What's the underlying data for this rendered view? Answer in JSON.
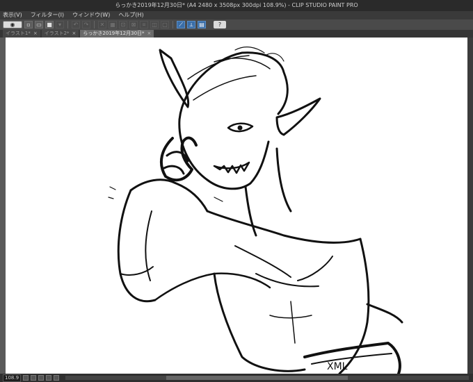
{
  "window": {
    "title": "らっかき2019年12月30日* (A4 2480 x 3508px 300dpi 108.9%)  - CLIP STUDIO PAINT PRO"
  },
  "menu": {
    "items": [
      "表示(V)",
      "フィルター(I)",
      "ウィンドウ(W)",
      "ヘルプ(H)"
    ]
  },
  "toolbar": {
    "help_label": "?"
  },
  "tabs": [
    {
      "label": "イラスト1*"
    },
    {
      "label": "イラスト2*"
    },
    {
      "label": "らっかき2019年12月30日*",
      "active": true
    }
  ],
  "status": {
    "zoom": "108.9"
  },
  "canvas": {
    "artwork": "ink sketch of a horned demon with pointed ears touching his face"
  }
}
